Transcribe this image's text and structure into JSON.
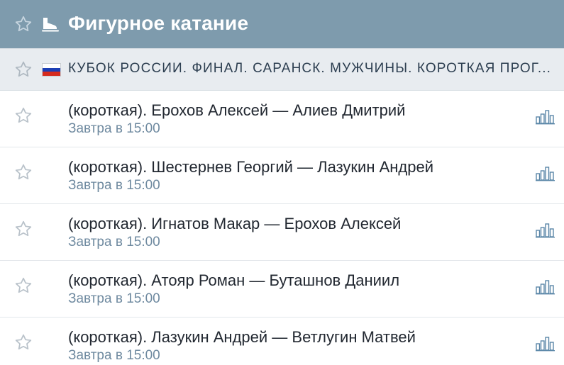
{
  "header": {
    "sport_title": "Фигурное катание",
    "icons": {
      "star": "star-outline-icon",
      "sport": "ice-skate-icon"
    },
    "colors": {
      "background": "#7e9bad",
      "text": "#ffffff"
    }
  },
  "tournament": {
    "title": "КУБОК РОССИИ. ФИНАЛ. САРАНСК. МУЖЧИНЫ. КОРОТКАЯ ПРОГ...",
    "flag": "russia-flag",
    "colors": {
      "background": "#e8ecf0"
    }
  },
  "events": [
    {
      "name": "(короткая). Ерохов Алексей — Алиев Дмитрий",
      "time": "Завтра в 15:00"
    },
    {
      "name": "(короткая). Шестернев Георгий — Лазукин Андрей",
      "time": "Завтра в 15:00"
    },
    {
      "name": "(короткая). Игнатов Макар — Ерохов Алексей",
      "time": "Завтра в 15:00"
    },
    {
      "name": "(короткая). Атояр Роман — Буташнов Даниил",
      "time": "Завтра в 15:00"
    },
    {
      "name": "(короткая). Лазукин Андрей — Ветлугин Матвей",
      "time": "Завтра в 15:00"
    }
  ],
  "event_icons": {
    "favorite": "star-outline-icon",
    "stats": "bar-chart-icon"
  },
  "colors": {
    "time_text": "#6f8aa0",
    "stats_icon": "#5b87a8",
    "star_outline": "#b9c2ca"
  }
}
